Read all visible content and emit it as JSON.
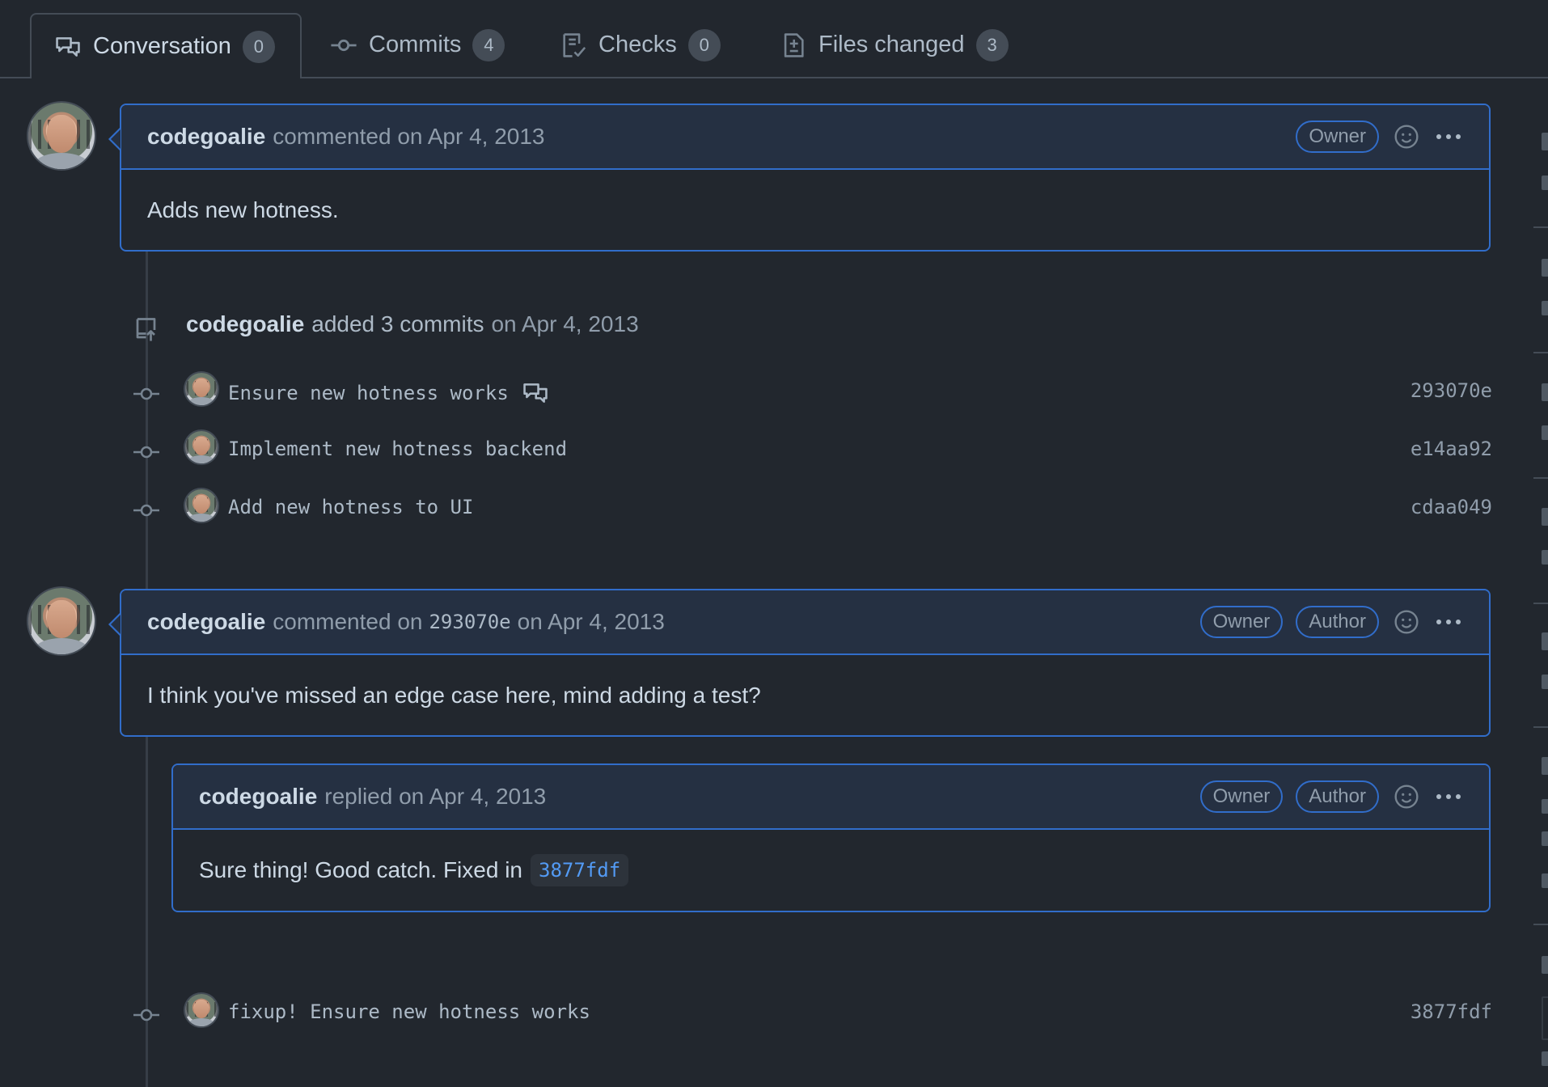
{
  "tabs": [
    {
      "label": "Conversation",
      "count": "0",
      "icon": "comment-discussion-icon"
    },
    {
      "label": "Commits",
      "count": "4",
      "icon": "git-commit-icon"
    },
    {
      "label": "Checks",
      "count": "0",
      "icon": "checklist-icon"
    },
    {
      "label": "Files changed",
      "count": "3",
      "icon": "file-diff-icon"
    }
  ],
  "comment1": {
    "author": "codegoalie",
    "action": "commented on Apr 4, 2013",
    "labels": [
      "Owner"
    ],
    "body": "Adds new hotness."
  },
  "push_event": {
    "author": "codegoalie",
    "action": "added 3 commits",
    "date": "on Apr 4, 2013",
    "icon": "repo-push-icon"
  },
  "commits": [
    {
      "message": "Ensure new hotness works",
      "sha": "293070e",
      "has_comment": true
    },
    {
      "message": "Implement new hotness backend",
      "sha": "e14aa92"
    },
    {
      "message": "Add new hotness to UI",
      "sha": "cdaa049"
    }
  ],
  "comment2": {
    "author": "codegoalie",
    "action_prefix": "commented on",
    "sha": "293070e",
    "action_suffix": "on Apr 4, 2013",
    "labels": [
      "Owner",
      "Author"
    ],
    "body": "I think you've missed an edge case here, mind adding a test?"
  },
  "reply": {
    "author": "codegoalie",
    "action": "replied on Apr 4, 2013",
    "labels": [
      "Owner",
      "Author"
    ],
    "body": "Sure thing! Good catch. Fixed in",
    "link": "3877fdf"
  },
  "fixup_commit": {
    "message": "fixup! Ensure new hotness works",
    "sha": "3877fdf"
  },
  "colors": {
    "background": "#22272e",
    "accent_border": "#316dca",
    "link": "#539bf5"
  }
}
